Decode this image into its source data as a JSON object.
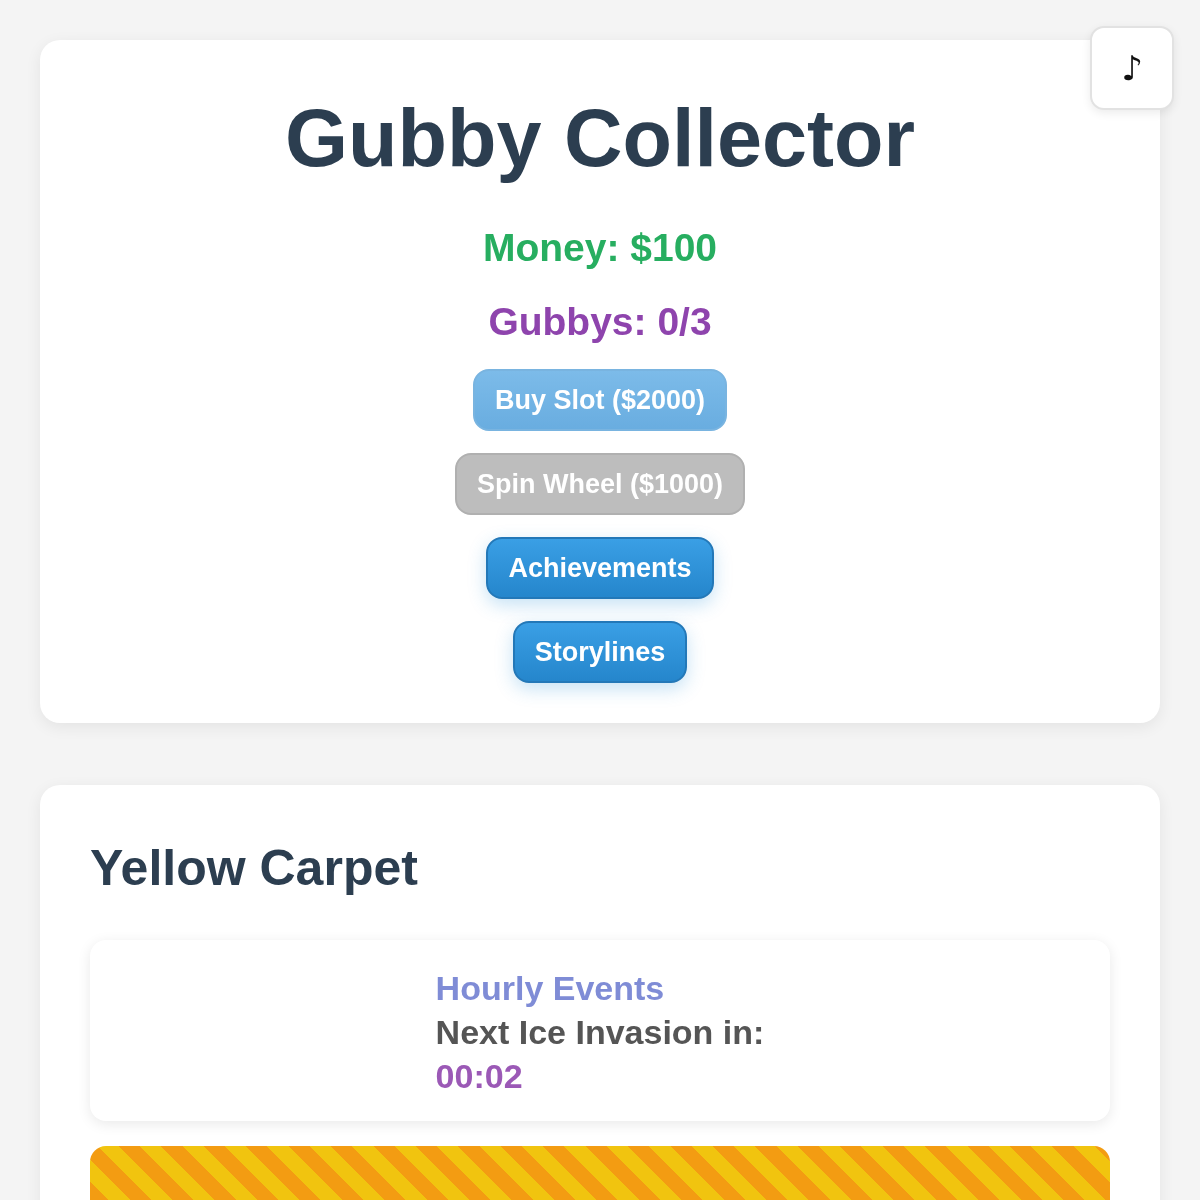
{
  "music_button": {
    "label": "♪"
  },
  "header": {
    "title": "Gubby Collector",
    "money": "Money: $100",
    "gubbys": "Gubbys: 0/3",
    "buttons": [
      {
        "label": "Buy Slot ($2000)",
        "kind": "primary",
        "disabled": true
      },
      {
        "label": "Spin Wheel ($1000)",
        "kind": "muted",
        "disabled": true
      },
      {
        "label": "Achievements",
        "kind": "primary",
        "disabled": false
      },
      {
        "label": "Storylines",
        "kind": "primary",
        "disabled": false
      }
    ]
  },
  "area": {
    "title": "Yellow Carpet",
    "event": {
      "title": "Hourly Events",
      "label": "Next Ice Invasion in:",
      "timer": "00:02"
    }
  }
}
